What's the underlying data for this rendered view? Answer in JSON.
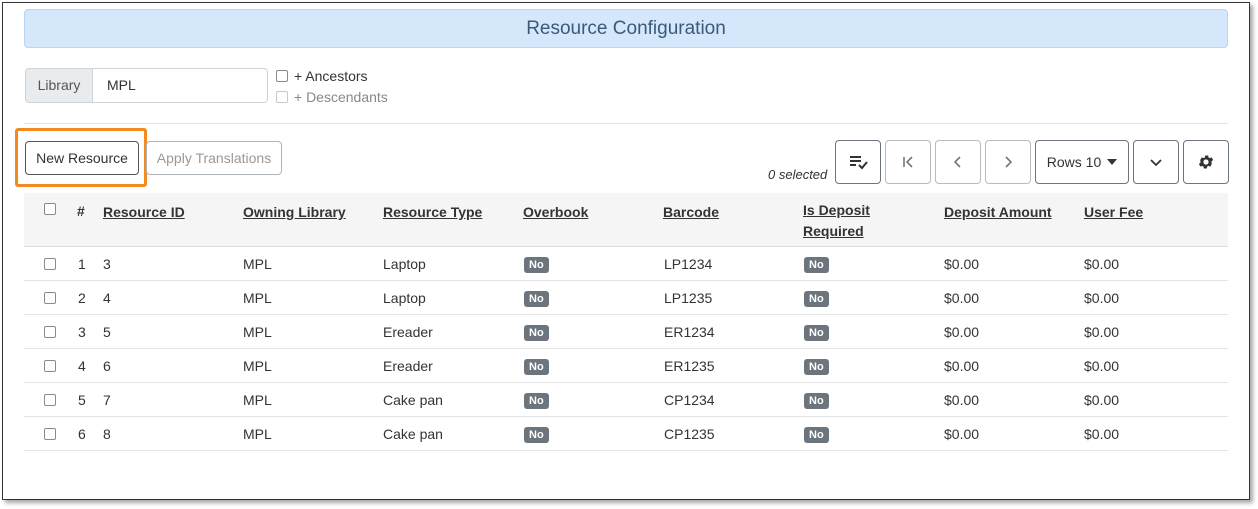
{
  "page": {
    "title": "Resource Configuration"
  },
  "filter": {
    "library_label": "Library",
    "library_value": "MPL",
    "ancestors_label": "+ Ancestors",
    "descendants_label": "+ Descendants"
  },
  "actions": {
    "new_resource": "New Resource",
    "apply_translations": "Apply Translations"
  },
  "grid": {
    "selected_text": "0 selected",
    "rows_label": "Rows 10",
    "columns": [
      "#",
      "Resource ID",
      "Owning Library",
      "Resource Type",
      "Overbook",
      "Barcode",
      "Is Deposit Required",
      "Deposit Amount",
      "User Fee"
    ],
    "rows": [
      {
        "num": "1",
        "id": "3",
        "lib": "MPL",
        "type": "Laptop",
        "overbook": "No",
        "barcode": "LP1234",
        "deposit_req": "No",
        "deposit_amt": "$0.00",
        "fee": "$0.00"
      },
      {
        "num": "2",
        "id": "4",
        "lib": "MPL",
        "type": "Laptop",
        "overbook": "No",
        "barcode": "LP1235",
        "deposit_req": "No",
        "deposit_amt": "$0.00",
        "fee": "$0.00"
      },
      {
        "num": "3",
        "id": "5",
        "lib": "MPL",
        "type": "Ereader",
        "overbook": "No",
        "barcode": "ER1234",
        "deposit_req": "No",
        "deposit_amt": "$0.00",
        "fee": "$0.00"
      },
      {
        "num": "4",
        "id": "6",
        "lib": "MPL",
        "type": "Ereader",
        "overbook": "No",
        "barcode": "ER1235",
        "deposit_req": "No",
        "deposit_amt": "$0.00",
        "fee": "$0.00"
      },
      {
        "num": "5",
        "id": "7",
        "lib": "MPL",
        "type": "Cake pan",
        "overbook": "No",
        "barcode": "CP1234",
        "deposit_req": "No",
        "deposit_amt": "$0.00",
        "fee": "$0.00"
      },
      {
        "num": "6",
        "id": "8",
        "lib": "MPL",
        "type": "Cake pan",
        "overbook": "No",
        "barcode": "CP1235",
        "deposit_req": "No",
        "deposit_amt": "$0.00",
        "fee": "$0.00"
      }
    ]
  },
  "icons": {
    "column_picker": "list-check-icon",
    "first_page": "first-page-icon",
    "prev_page": "chevron-left-icon",
    "next_page": "chevron-right-icon",
    "expand": "chevron-down-icon",
    "settings": "gear-icon"
  },
  "colors": {
    "header_bg": "#d4e7fb",
    "highlight": "#f5891f",
    "badge": "#6c757d"
  }
}
